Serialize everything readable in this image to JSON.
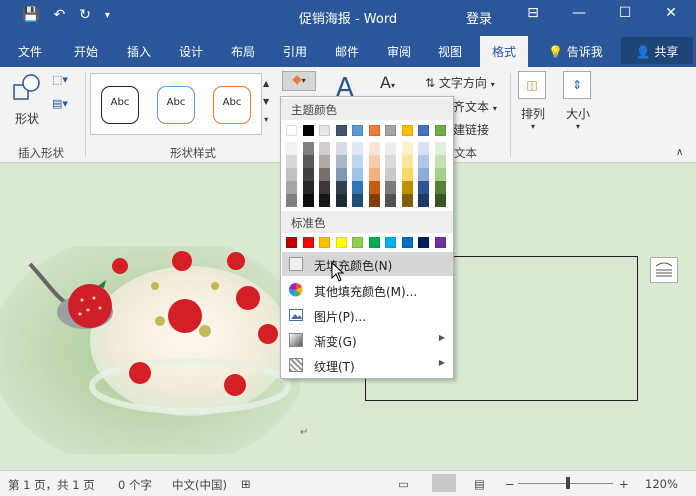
{
  "window": {
    "title": "促销海报 - Word",
    "login": "登录",
    "controls": [
      "⊟",
      "—",
      "☐",
      "✕"
    ]
  },
  "tabs": [
    {
      "label": "文件"
    },
    {
      "label": "开始"
    },
    {
      "label": "插入"
    },
    {
      "label": "设计"
    },
    {
      "label": "布局"
    },
    {
      "label": "引用"
    },
    {
      "label": "邮件"
    },
    {
      "label": "审阅"
    },
    {
      "label": "视图"
    },
    {
      "label": "格式",
      "active": true
    }
  ],
  "tellme": "告诉我",
  "share": "共享",
  "ribbon": {
    "insert_shape": {
      "button": "形状",
      "label": "插入形状"
    },
    "shape_styles": {
      "sample": "Abc",
      "label": "形状样式"
    },
    "text": {
      "direction": "文字方向",
      "align": "齐文本",
      "link": "建链接",
      "label": "文本"
    },
    "arrange": "排列",
    "size": "大小"
  },
  "fill_menu": {
    "theme_header": "主题颜色",
    "standard_header": "标准色",
    "theme_top": [
      "#ffffff",
      "#000000",
      "#e7e6e6",
      "#44546a",
      "#5b9bd5",
      "#ed7d31",
      "#a5a5a5",
      "#ffc000",
      "#4472c4",
      "#70ad47"
    ],
    "theme_shades": [
      [
        "#f2f2f2",
        "#d9d9d9",
        "#bfbfbf",
        "#a6a6a6",
        "#808080"
      ],
      [
        "#808080",
        "#595959",
        "#404040",
        "#262626",
        "#0d0d0d"
      ],
      [
        "#d0cece",
        "#aeaaaa",
        "#757070",
        "#3a3838",
        "#171616"
      ],
      [
        "#d6dce4",
        "#adb9ca",
        "#8497b0",
        "#333f4f",
        "#222a35"
      ],
      [
        "#deebf6",
        "#bdd7ee",
        "#9dc3e6",
        "#2e75b5",
        "#1f4e79"
      ],
      [
        "#fbe5d5",
        "#f7cbac",
        "#f4b183",
        "#c55a11",
        "#833c0b"
      ],
      [
        "#ededed",
        "#dbdbdb",
        "#c9c9c9",
        "#7b7b7b",
        "#525252"
      ],
      [
        "#fff2cc",
        "#fee599",
        "#ffd965",
        "#bf9000",
        "#7f6000"
      ],
      [
        "#d9e2f3",
        "#b4c6e7",
        "#8eaadb",
        "#2f5496",
        "#1f3864"
      ],
      [
        "#e2efd9",
        "#c5e0b3",
        "#a8d08d",
        "#538135",
        "#375623"
      ]
    ],
    "standard": [
      "#c00000",
      "#ff0000",
      "#ffc000",
      "#ffff00",
      "#92d050",
      "#00b050",
      "#00b0f0",
      "#0070c0",
      "#002060",
      "#7030a0"
    ],
    "items": [
      {
        "label": "无填充颜色(N)",
        "icon": "no-fill-icon"
      },
      {
        "label": "其他填充颜色(M)...",
        "icon": "color-wheel-icon"
      },
      {
        "label": "图片(P)...",
        "icon": "picture-icon"
      },
      {
        "label": "渐变(G)",
        "icon": "gradient-icon",
        "submenu": true
      },
      {
        "label": "纹理(T)",
        "icon": "texture-icon",
        "submenu": true
      }
    ]
  },
  "status": {
    "page": "第 1 页，共 1 页",
    "words": "0 个字",
    "lang": "中文(中国)",
    "zoom": "120%"
  }
}
